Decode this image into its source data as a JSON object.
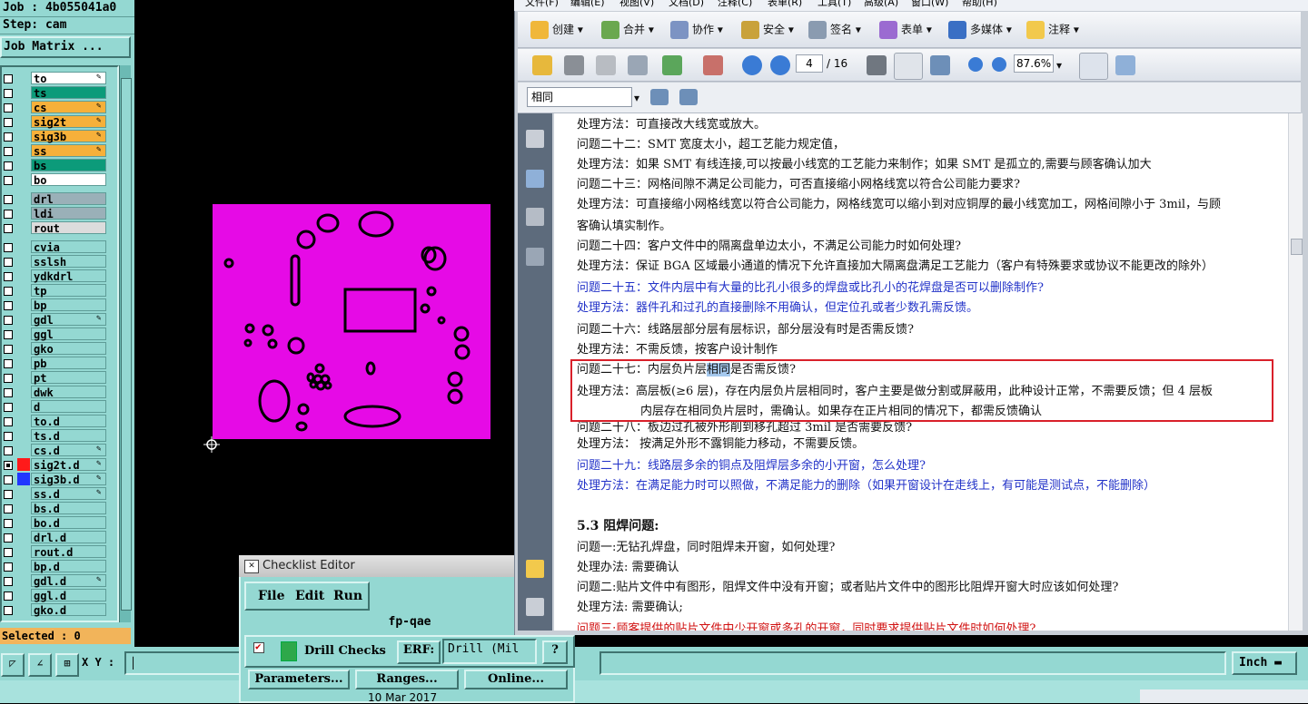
{
  "genesis": {
    "job": "Job : 4b055041a0",
    "step": "Step: cam",
    "job_matrix": "Job Matrix ...",
    "selected": "Selected : 0",
    "xy_label": "X Y :",
    "units": "Inch",
    "layers": [
      {
        "name": "to",
        "color": "#ffffff",
        "check": false,
        "edit": true
      },
      {
        "name": "ts",
        "color": "#0c9b7a",
        "check": false,
        "edit": false
      },
      {
        "name": "cs",
        "color": "#f6b03a",
        "check": false,
        "edit": true
      },
      {
        "name": "sig2t",
        "color": "#f6b03a",
        "check": false,
        "edit": true
      },
      {
        "name": "sig3b",
        "color": "#f6b03a",
        "check": false,
        "edit": true
      },
      {
        "name": "ss",
        "color": "#f6b03a",
        "check": false,
        "edit": true
      },
      {
        "name": "bs",
        "color": "#0c9b7a",
        "check": false,
        "edit": false
      },
      {
        "name": "bo",
        "color": "#ffffff",
        "check": false,
        "edit": false
      },
      {
        "name": "drl",
        "color": "#9ab0b8",
        "check": false,
        "edit": false
      },
      {
        "name": "ldi",
        "color": "#9ab0b8",
        "check": false,
        "edit": false
      },
      {
        "name": "rout",
        "color": "#dcdcdc",
        "check": false,
        "edit": false
      },
      {
        "name": "cvia",
        "color": "#94d8d2",
        "check": false,
        "edit": false
      },
      {
        "name": "sslsh",
        "color": "#94d8d2",
        "check": false,
        "edit": false
      },
      {
        "name": "ydkdrl",
        "color": "#94d8d2",
        "check": false,
        "edit": false
      },
      {
        "name": "tp",
        "color": "#94d8d2",
        "check": false,
        "edit": false
      },
      {
        "name": "bp",
        "color": "#94d8d2",
        "check": false,
        "edit": false
      },
      {
        "name": "gdl",
        "color": "#94d8d2",
        "check": false,
        "edit": true
      },
      {
        "name": "ggl",
        "color": "#94d8d2",
        "check": false,
        "edit": false
      },
      {
        "name": "gko",
        "color": "#94d8d2",
        "check": false,
        "edit": false
      },
      {
        "name": "pb",
        "color": "#94d8d2",
        "check": false,
        "edit": false
      },
      {
        "name": "pt",
        "color": "#94d8d2",
        "check": false,
        "edit": false
      },
      {
        "name": "dwk",
        "color": "#94d8d2",
        "check": false,
        "edit": false
      },
      {
        "name": "d",
        "color": "#94d8d2",
        "check": false,
        "edit": false
      },
      {
        "name": "to.d",
        "color": "#94d8d2",
        "check": false,
        "edit": false
      },
      {
        "name": "ts.d",
        "color": "#94d8d2",
        "check": false,
        "edit": false
      },
      {
        "name": "cs.d",
        "color": "#94d8d2",
        "check": false,
        "edit": true
      },
      {
        "name": "sig2t.d",
        "color": "#94d8d2",
        "check": true,
        "edit": true,
        "swatch": "#ff1a1a"
      },
      {
        "name": "sig3b.d",
        "color": "#94d8d2",
        "check": false,
        "edit": true,
        "swatch": "#2036ff"
      },
      {
        "name": "ss.d",
        "color": "#94d8d2",
        "check": false,
        "edit": true
      },
      {
        "name": "bs.d",
        "color": "#94d8d2",
        "check": false,
        "edit": false
      },
      {
        "name": "bo.d",
        "color": "#94d8d2",
        "check": false,
        "edit": false
      },
      {
        "name": "drl.d",
        "color": "#94d8d2",
        "check": false,
        "edit": false
      },
      {
        "name": "rout.d",
        "color": "#94d8d2",
        "check": false,
        "edit": false
      },
      {
        "name": "bp.d",
        "color": "#94d8d2",
        "check": false,
        "edit": false
      },
      {
        "name": "gdl.d",
        "color": "#94d8d2",
        "check": false,
        "edit": true
      },
      {
        "name": "ggl.d",
        "color": "#94d8d2",
        "check": false,
        "edit": false
      },
      {
        "name": "gko.d",
        "color": "#94d8d2",
        "check": false,
        "edit": false
      }
    ]
  },
  "checklist": {
    "title": "Checklist Editor",
    "menu": [
      "File",
      "Edit",
      "Run"
    ],
    "name": "fp-qae",
    "check_label": "Drill Checks",
    "erf_label": "ERF:",
    "erf_value": "Drill (Mil",
    "help": "?",
    "buttons": [
      "Parameters...",
      "Ranges...",
      "Online..."
    ],
    "date": "10 Mar 2017"
  },
  "pdf": {
    "menu": [
      "文件(F)",
      "编辑(E)",
      "视图(V)",
      "文档(D)",
      "注释(C)",
      "表单(R)",
      "工具(T)",
      "高级(A)",
      "窗口(W)",
      "帮助(H)"
    ],
    "toolbar": [
      "创建",
      "合并",
      "协作",
      "安全",
      "签名",
      "表单",
      "多媒体",
      "注释"
    ],
    "page_current": "4",
    "page_total": "/ 16",
    "zoom": "87.6%",
    "search_value": "相同",
    "lines": [
      {
        "text": "处理方法：可直接改大线宽或放大。",
        "style": ""
      },
      {
        "text": "问题二十二：SMT 宽度太小，超工艺能力规定值，",
        "style": ""
      },
      {
        "text": "处理方法：如果 SMT 有线连接,可以按最小线宽的工艺能力来制作；如果 SMT 是孤立的,需要与顾客确认加大",
        "style": ""
      },
      {
        "text": "问题二十三：网格间隙不满足公司能力，可否直接缩小网格线宽以符合公司能力要求?",
        "style": ""
      },
      {
        "text": "处理方法：可直接缩小网格线宽以符合公司能力，网格线宽可以缩小到对应铜厚的最小线宽加工，网格间隙小于 3mil，与顾",
        "style": ""
      },
      {
        "text": "客确认填实制作。",
        "style": ""
      },
      {
        "text": "问题二十四：客户文件中的隔离盘单边太小，不满足公司能力时如何处理?",
        "style": ""
      },
      {
        "text": "处理方法：保证 BGA 区域最小通道的情况下允许直接加大隔离盘满足工艺能力（客户有特殊要求或协议不能更改的除外）",
        "style": ""
      },
      {
        "text": "问题二十五：文件内层中有大量的比孔小很多的焊盘或比孔小的花焊盘是否可以删除制作?",
        "style": "blue"
      },
      {
        "text": "处理方法：器件孔和过孔的直接删除不用确认，但定位孔或者少数孔需反馈。",
        "style": "blue"
      },
      {
        "text": "问题二十六：线路层部分层有层标识，部分层没有时是否需反馈?",
        "style": ""
      },
      {
        "text": "处理方法：不需反馈，按客户设计制作",
        "style": ""
      },
      {
        "text_pre": "问题二十七：内层负片层",
        "text_hl": "相同",
        "text_post": "是否需反馈?",
        "style": "hl"
      },
      {
        "text": "处理方法：高层板(≥6 层)，存在内层负片层相同时，客户主要是做分割或屏蔽用，此种设计正常，不需要反馈；但 4 层板",
        "style": ""
      },
      {
        "text": "内层存在相同负片层时，需确认。如果存在正片相同的情况下，都需反馈确认",
        "style": "indent"
      },
      {
        "text": "问题二十八：板边过孔被外形削到移孔超过 3mil 是否需要反馈?",
        "style": ""
      },
      {
        "text": "处理方法： 按满足外形不露铜能力移动，不需要反馈。",
        "style": ""
      },
      {
        "text": "问题二十九：线路层多余的铜点及阻焊层多余的小开窗，怎么处理?",
        "style": "blue"
      },
      {
        "text": "处理方法：在满足能力时可以照做，不满足能力的删除（如果开窗设计在走线上，有可能是测试点，不能删除）",
        "style": "blue"
      },
      {
        "text": "5.3 阻焊问题:",
        "style": "heading"
      },
      {
        "text": "问题一:无钻孔焊盘，同时阻焊未开窗，如何处理?",
        "style": ""
      },
      {
        "text": "处理办法: 需要确认",
        "style": ""
      },
      {
        "text": "问题二:贴片文件中有图形，阻焊文件中没有开窗；或者贴片文件中的图形比阻焊开窗大时应该如何处理?",
        "style": ""
      },
      {
        "text": "处理方法: 需要确认;",
        "style": ""
      },
      {
        "text": "问题三:顾客提供的贴片文件中少开窗或多孔的开窗，同时要求提供贴片文件时如何处理?",
        "style": "red"
      }
    ],
    "colors": {
      "accent_blue": "#2232c8",
      "box_red": "#d9202a",
      "board": "#e60ae6"
    }
  }
}
